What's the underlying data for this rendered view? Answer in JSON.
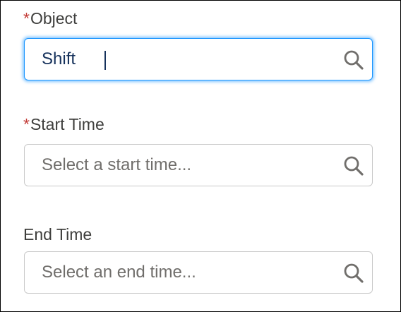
{
  "fields": {
    "object": {
      "required_mark": "*",
      "label": "Object",
      "value": "Shift",
      "placeholder": ""
    },
    "start_time": {
      "required_mark": "*",
      "label": "Start Time",
      "value": "",
      "placeholder": "Select a start time..."
    },
    "end_time": {
      "label": "End Time",
      "value": "",
      "placeholder": "Select an end time..."
    }
  },
  "icons": {
    "search": "search-icon"
  },
  "colors": {
    "required": "#c23934",
    "focus_ring": "#1b96ff",
    "label": "#3e3e3c",
    "input_text": "#16325c",
    "placeholder": "#706e6b",
    "border": "#c9c9c9"
  }
}
